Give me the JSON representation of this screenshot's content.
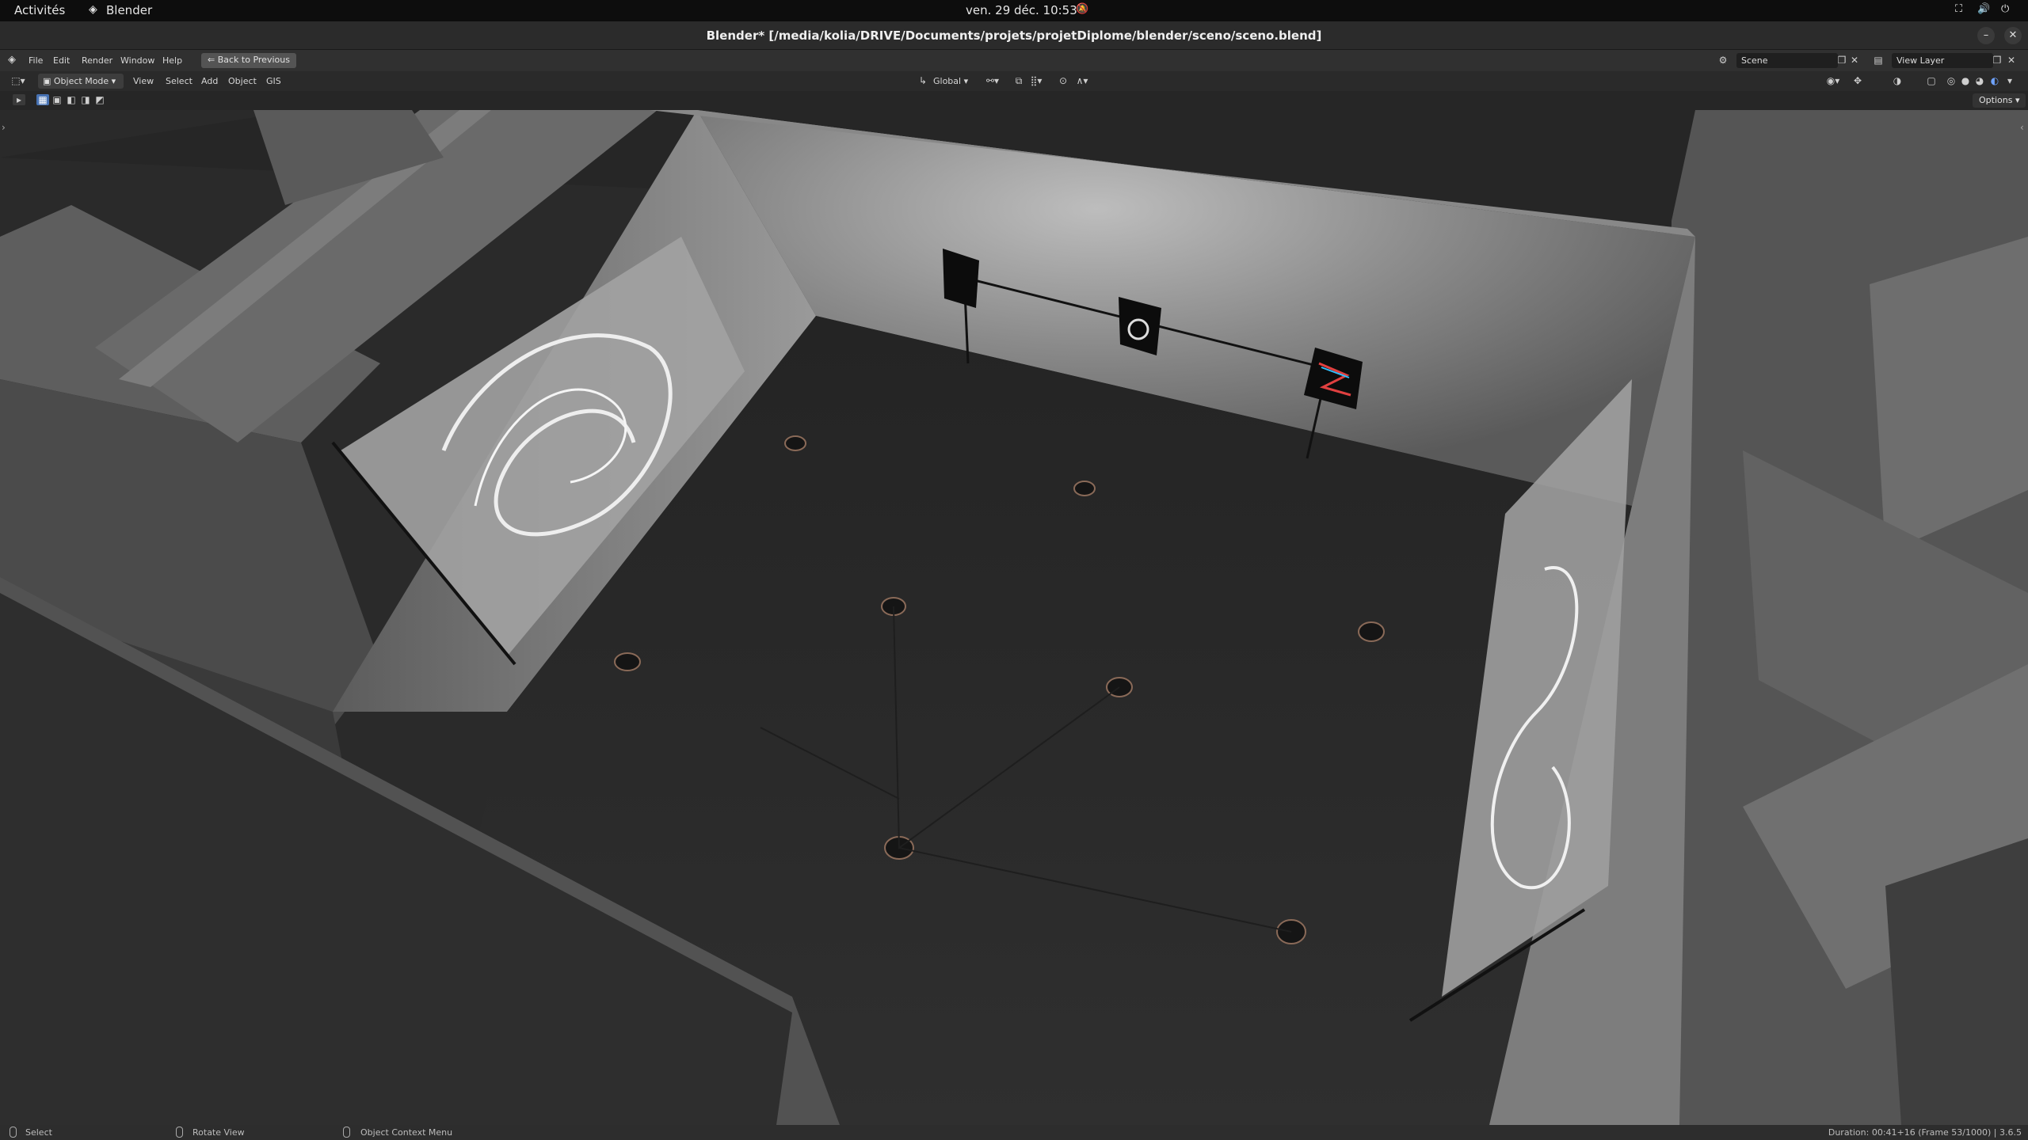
{
  "gnome": {
    "activities": "Activités",
    "app": "Blender",
    "clock": "ven. 29 déc.  10:53"
  },
  "window": {
    "title": "Blender* [/media/kolia/DRIVE/Documents/projets/projetDiplome/blender/sceno/sceno.blend]"
  },
  "menu": {
    "file": "File",
    "edit": "Edit",
    "render": "Render",
    "window": "Window",
    "help": "Help",
    "back": "Back to Previous",
    "scene": "Scene",
    "view_layer": "View Layer"
  },
  "viewport_header": {
    "mode": "Object Mode",
    "view": "View",
    "select": "Select",
    "add": "Add",
    "object": "Object",
    "gis": "GIS",
    "orientation": "Global",
    "options": "Options"
  },
  "status": {
    "select": "Select",
    "rotate": "Rotate View",
    "context": "Object Context Menu",
    "info": "Duration: 00:41+16 (Frame 53/1000) | 3.6.5"
  }
}
